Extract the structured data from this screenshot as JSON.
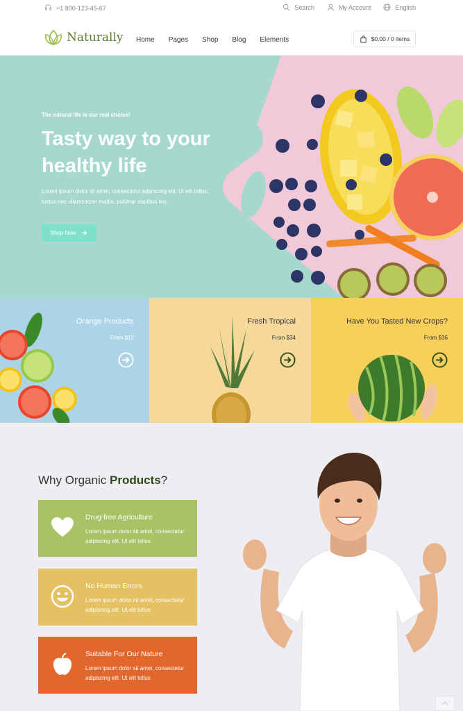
{
  "topbar": {
    "phone": "+1 800-123-45-67",
    "search_label": "Search",
    "account_label": "My Account",
    "language_label": "English"
  },
  "header": {
    "logo_text": "Naturally",
    "nav": [
      "Home",
      "Pages",
      "Shop",
      "Blog",
      "Elements"
    ],
    "cart_label": "$0.00 / 0 items"
  },
  "hero": {
    "tagline": "The natural life is our real choise!",
    "title": "Tasty way to your healthy life",
    "description": "Lorem ipsum dolor sit amet, consectetur adipiscing elit. Ut elit tellus, luctus nec ullamcorper mattis, pulvinar dapibus leo.",
    "button_label": "Shop Now"
  },
  "categories": [
    {
      "title": "Orange Products",
      "price": "From $12",
      "bg": "#acd4e8"
    },
    {
      "title": "Fresh Tropical",
      "price": "From $34",
      "bg": "#f6d99a"
    },
    {
      "title": "Have You Tasted New Crops?",
      "price": "From $36",
      "bg": "#f8cf5a"
    }
  ],
  "why": {
    "title_prefix": "Why Organic ",
    "title_bold": "Products",
    "title_suffix": "?",
    "features": [
      {
        "title": "Drug-free Agriculture",
        "description": "Lorem ipsum dolor sit amet, consectetur adipiscing elit. Ut elit tellus",
        "color": "#a9c266",
        "icon": "heart-icon"
      },
      {
        "title": "No Human Errors",
        "description": "Lorem ipsum dolor sit amet, consectetur adipiscing elit. Ut elit tellus",
        "color": "#e5c163",
        "icon": "smile-icon"
      },
      {
        "title": "Suitable For Our Nature",
        "description": "Lorem ipsum dolor sit amet, consectetur adipiscing elit. Ut elit tellus",
        "color": "#e2672d",
        "icon": "apple-icon"
      }
    ]
  },
  "colors": {
    "brand": "#5c7d2e",
    "hero_bg": "#a6d8cd",
    "accent_button": "#7fe0cc"
  }
}
